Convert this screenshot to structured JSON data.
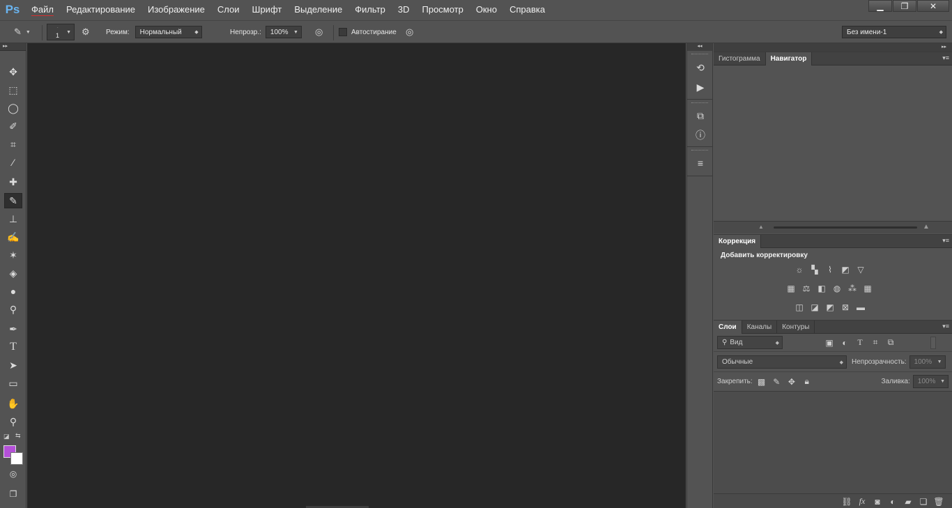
{
  "app": {
    "logo": "Ps"
  },
  "menu": [
    "Файл",
    "Редактирование",
    "Изображение",
    "Слои",
    "Шрифт",
    "Выделение",
    "Фильтр",
    "3D",
    "Просмотр",
    "Окно",
    "Справка"
  ],
  "window_controls": {
    "minimize": "▁",
    "restore": "❐",
    "close": "✕"
  },
  "options": {
    "brush_size": "1",
    "mode_label": "Режим:",
    "mode_value": "Нормальный",
    "opacity_label": "Непрозр.:",
    "opacity_value": "100%",
    "auto_erase_label": "Автостирание",
    "document_select": "Без имени-1"
  },
  "panels": {
    "navigator_tabs": [
      "Гистограмма",
      "Навигатор"
    ],
    "correction_tab": "Коррекция",
    "add_correction": "Добавить корректировку",
    "layers_tabs": [
      "Слои",
      "Каналы",
      "Контуры"
    ],
    "filter_kind": "Вид",
    "blend_mode": "Обычные",
    "opacity_label": "Непрозрачность:",
    "opacity_value": "100%",
    "lock_label": "Закрепить:",
    "fill_label": "Заливка:",
    "fill_value": "100%"
  },
  "colors": {
    "foreground": "#b450d8",
    "background": "#ffffff",
    "canvas": "#272727"
  }
}
